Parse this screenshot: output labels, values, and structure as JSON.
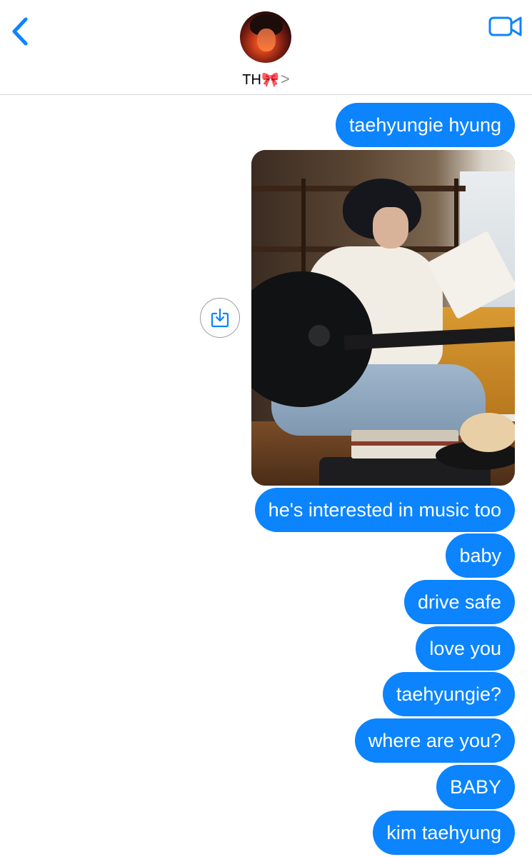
{
  "header": {
    "back_icon": "chevron-left-icon",
    "contact_name": "TH🎀",
    "chevron": ">",
    "facetime_icon": "video-camera-icon",
    "accent_color": "#0b84fe"
  },
  "thread": {
    "messages_before_photo": [
      {
        "text": "taehyungie hyung"
      }
    ],
    "photo": {
      "alt": "photo attachment",
      "share_icon": "save-to-photos-icon"
    },
    "messages_after_photo": [
      {
        "text": "he's interested in music too"
      },
      {
        "text": "baby"
      },
      {
        "text": "drive safe"
      },
      {
        "text": "love you"
      },
      {
        "text": "taehyungie?"
      },
      {
        "text": "where are you?"
      },
      {
        "text": "BABY"
      },
      {
        "text": "kim taehyung"
      }
    ],
    "bubble_color": "#0b84fe",
    "bubble_text_color": "#ffffff"
  }
}
